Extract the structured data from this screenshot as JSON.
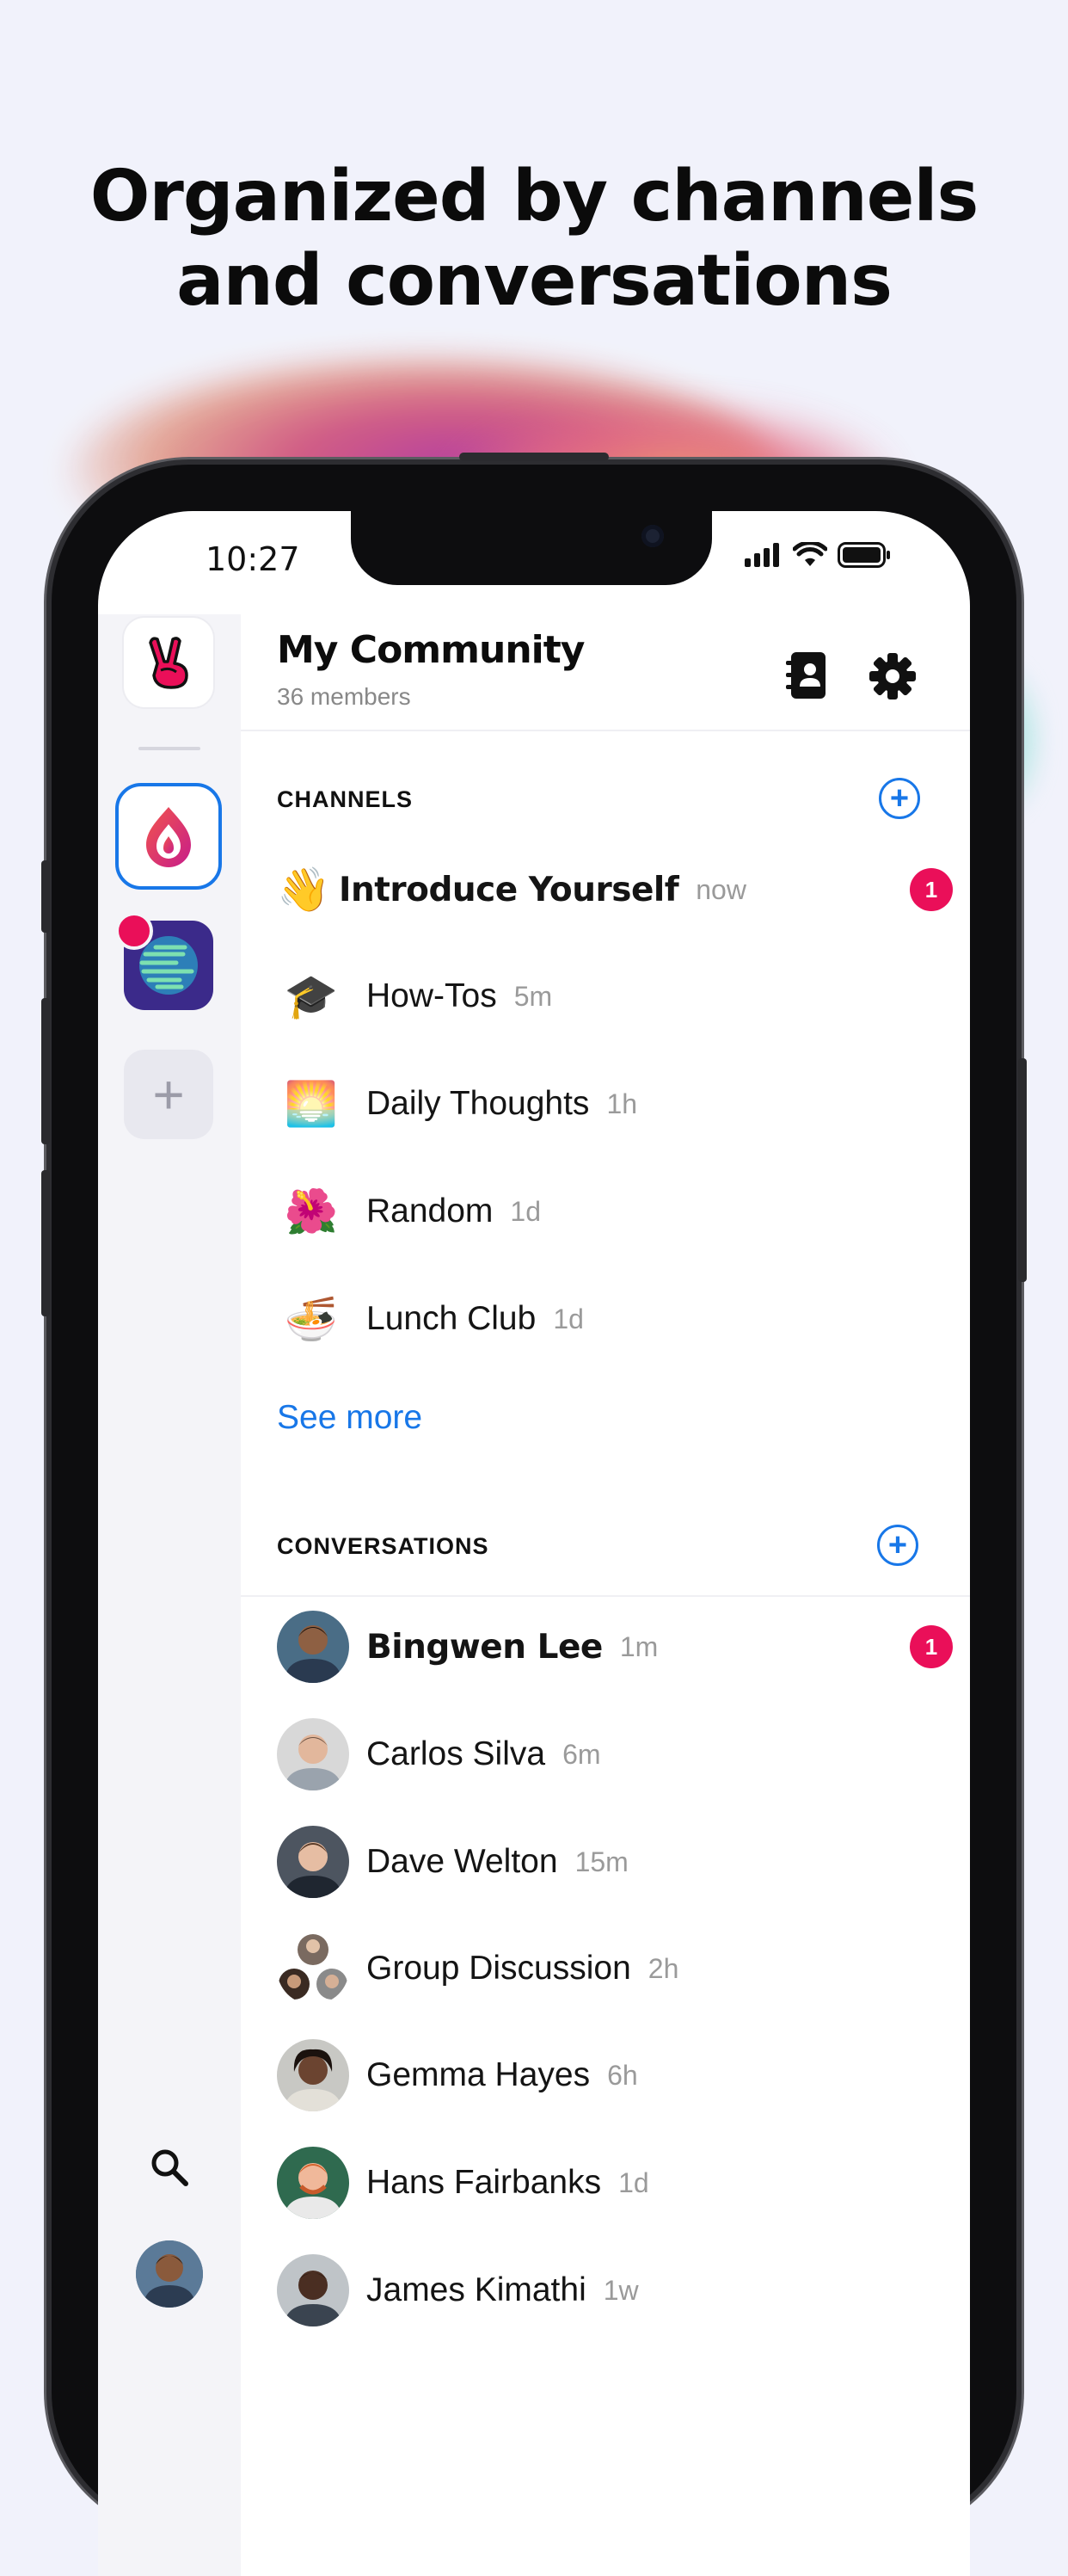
{
  "headline": {
    "line1": "Organized by channels",
    "line2": "and conversations"
  },
  "status_bar": {
    "time": "10:27",
    "icons": [
      "cellular-icon",
      "wifi-icon",
      "battery-icon"
    ]
  },
  "community": {
    "name": "My Community",
    "members": "36 members",
    "header_icons": [
      "contacts-book-icon",
      "gear-icon"
    ]
  },
  "rail": {
    "items": [
      {
        "name": "peace-hand-community-icon"
      },
      {
        "name": "flame-community-icon",
        "selected": true
      },
      {
        "name": "globe-community-icon",
        "has_notification": true
      },
      {
        "name": "add-community-icon",
        "label": "+"
      }
    ],
    "bottom": [
      "search-icon",
      "profile-avatar"
    ]
  },
  "channels": {
    "title": "CHANNELS",
    "add_label": "+",
    "items": [
      {
        "emoji": "👋",
        "name": "Introduce Yourself",
        "time": "now",
        "unread": "1",
        "bold": true
      },
      {
        "emoji": "🎓",
        "name": "How-Tos",
        "time": "5m"
      },
      {
        "emoji": "🌅",
        "name": "Daily Thoughts",
        "time": "1h"
      },
      {
        "emoji": "🌺",
        "name": "Random",
        "time": "1d"
      },
      {
        "emoji": "🍜",
        "name": "Lunch Club",
        "time": "1d"
      }
    ],
    "see_more": "See more"
  },
  "conversations": {
    "title": "CONVERSATIONS",
    "add_label": "+",
    "items": [
      {
        "name": "Bingwen Lee",
        "time": "1m",
        "unread": "1",
        "bold": true
      },
      {
        "name": "Carlos Silva",
        "time": "6m"
      },
      {
        "name": "Dave Welton",
        "time": "15m"
      },
      {
        "name": "Group Discussion",
        "time": "2h"
      },
      {
        "name": "Gemma Hayes",
        "time": "6h"
      },
      {
        "name": "Hans Fairbanks",
        "time": "1d"
      },
      {
        "name": "James Kimathi",
        "time": "1w"
      }
    ]
  },
  "colors": {
    "accent": "#1877e8",
    "badge": "#ea0f59",
    "background": "#f1f2fb"
  }
}
